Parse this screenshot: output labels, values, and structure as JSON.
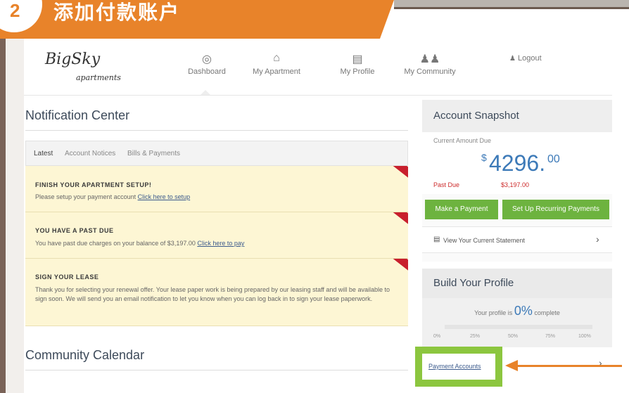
{
  "banner": {
    "step": "2",
    "title": "添加付款账户"
  },
  "logo": {
    "name": "BigSky",
    "sub": "apartments"
  },
  "nav": [
    {
      "label": "Dashboard",
      "icon": "compass-icon"
    },
    {
      "label": "My Apartment",
      "icon": "house-icon"
    },
    {
      "label": "My Profile",
      "icon": "id-card-icon"
    },
    {
      "label": "My Community",
      "icon": "people-icon"
    },
    {
      "label": "Logout",
      "icon": "people-small-icon"
    }
  ],
  "notification_center": {
    "title": "Notification Center",
    "tabs": [
      "Latest",
      "Account Notices",
      "Bills & Payments"
    ],
    "notices": [
      {
        "title": "FINISH YOUR APARTMENT SETUP!",
        "text": "Please setup your payment account",
        "link": "Click here to setup"
      },
      {
        "title": "YOU HAVE A PAST DUE",
        "text": "You have past due charges on your balance of $3,197.00",
        "link": "Click here to pay"
      },
      {
        "title": "SIGN YOUR LEASE",
        "text": "Thank you for selecting your renewal offer. Your lease paper work is being prepared by our leasing staff and will be available to sign soon. We will send you an email notification to let you know when you can log back in to sign your lease paperwork.",
        "link": ""
      }
    ]
  },
  "community_calendar": {
    "title": "Community Calendar"
  },
  "account_snapshot": {
    "title": "Account Snapshot",
    "amount_label": "Current Amount Due",
    "amount_dollar": "$",
    "amount_main": "4296.",
    "amount_cents": "00",
    "past_due_label": "Past Due",
    "past_due_value": "$3,197.00",
    "make_payment": "Make a Payment",
    "recurring": "Set Up Recurring Payments",
    "statement": "View Your Current Statement"
  },
  "build_profile": {
    "title": "Build Your Profile",
    "prefix": "Your profile is",
    "percent": "0%",
    "suffix": "complete",
    "progress": 0,
    "ticks": [
      "0%",
      "25%",
      "50%",
      "75%",
      "100%"
    ]
  },
  "payment_accounts": {
    "label": "Payment Accounts"
  },
  "colors": {
    "accent": "#e8832a",
    "green": "#6db33f",
    "highlight": "#8cc63f",
    "ribbon": "#c81f2d",
    "amount": "#3d7ab8"
  }
}
